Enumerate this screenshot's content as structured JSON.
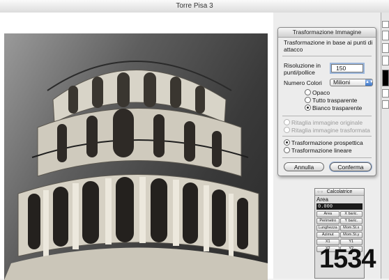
{
  "window": {
    "title": "Torre Pisa 3"
  },
  "dialog": {
    "title": "Trasformazione Immagine",
    "heading": "Trasformazione in base ai punti di attacco",
    "resolution": {
      "label": "Risoluzione in punti/pollice",
      "value": "150"
    },
    "colors": {
      "label": "Numero Colori",
      "selected": "Milioni"
    },
    "background_options": [
      {
        "label": "Opaco",
        "selected": false
      },
      {
        "label": "Tutto trasparente",
        "selected": false
      },
      {
        "label": "Bianco trasparente",
        "selected": true
      }
    ],
    "crop_options": [
      {
        "label": "Ritaglia immagine originale",
        "selected": false,
        "enabled": false
      },
      {
        "label": "Ritaglia immagine trasformata",
        "selected": false,
        "enabled": false
      }
    ],
    "transform_options": [
      {
        "label": "Trasformazione prospettica",
        "selected": true
      },
      {
        "label": "Trasformazione lineare",
        "selected": false
      }
    ],
    "cancel_label": "Annulla",
    "confirm_label": "Conferma"
  },
  "calculator": {
    "title": "Calcolatrice",
    "label": "Area",
    "display": "0.000",
    "keys": [
      "Area",
      "X baric.",
      "Perimetro",
      "Y baric.",
      "Lunghezza",
      "Mom.St.x",
      "Azimut",
      "Mom.St.y",
      "X1",
      "Y1",
      "X2",
      "Y2"
    ]
  },
  "page_number": "1534"
}
